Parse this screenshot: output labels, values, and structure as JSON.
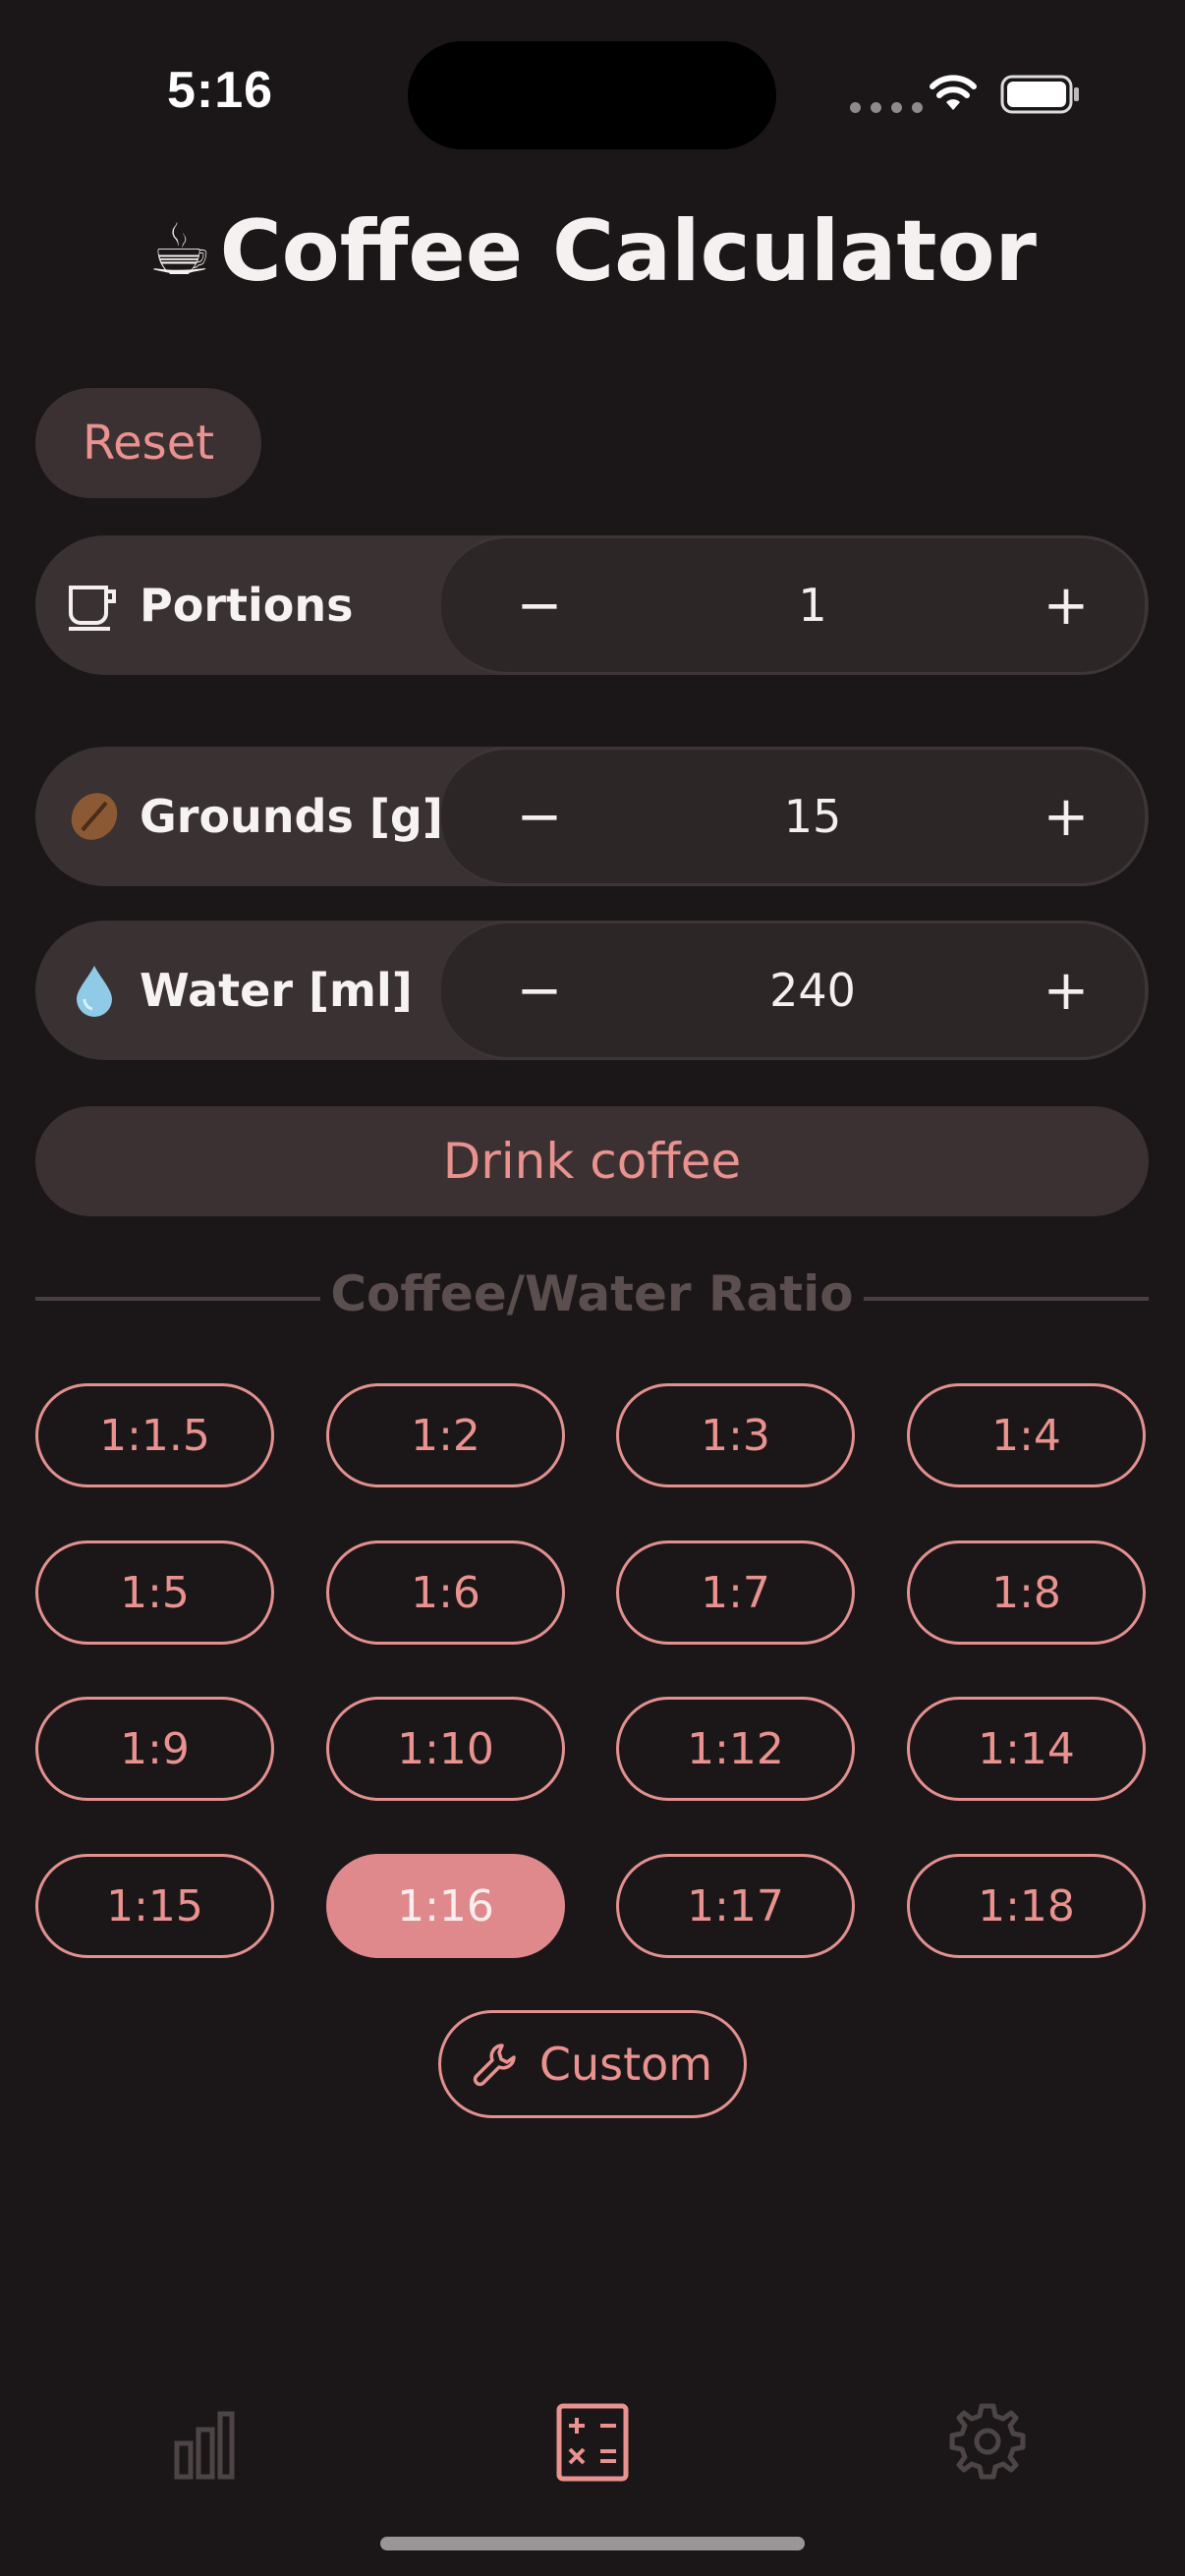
{
  "status_bar": {
    "time": "5:16"
  },
  "title": {
    "icon": "☕",
    "text": "Coffee Calculator"
  },
  "reset_label": "Reset",
  "rows": [
    {
      "label": "Portions",
      "value": "1",
      "minus": "−",
      "plus": "+"
    },
    {
      "label": "Grounds [g]",
      "value": "15",
      "minus": "−",
      "plus": "+"
    },
    {
      "label": "Water [ml]",
      "value": "240",
      "minus": "−",
      "plus": "+"
    }
  ],
  "drink_label": "Drink coffee",
  "ratio": {
    "heading": "Coffee/Water Ratio",
    "options": [
      "1:1.5",
      "1:2",
      "1:3",
      "1:4",
      "1:5",
      "1:6",
      "1:7",
      "1:8",
      "1:9",
      "1:10",
      "1:12",
      "1:14",
      "1:15",
      "1:16",
      "1:17",
      "1:18"
    ],
    "selected": "1:16",
    "custom_label": "Custom"
  },
  "colors": {
    "accent": "#e9928f",
    "background": "#1b1718",
    "surface": "#3a3132",
    "selected": "#e0898c"
  },
  "tab_bar": {
    "icons": [
      "stats-icon",
      "calculator-icon",
      "settings-icon"
    ],
    "active": "calculator-icon"
  }
}
